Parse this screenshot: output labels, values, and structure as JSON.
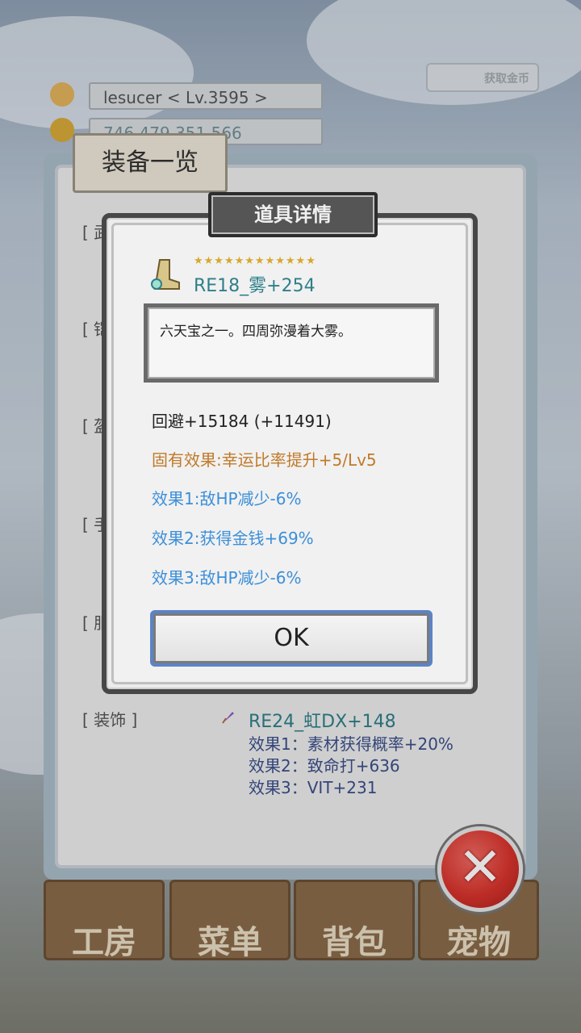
{
  "player": {
    "name_level": "lesucer    < Lv.3595 >",
    "gold": "746,479,351,566"
  },
  "auto_button_label": "获取金币",
  "bottom_nav": [
    {
      "label": "工房"
    },
    {
      "label": "菜单"
    },
    {
      "label": "背包"
    },
    {
      "label": "宠物"
    }
  ],
  "equipment_panel": {
    "title": "装备一览",
    "slots": [
      "[ 武",
      "[ 铠",
      "[ 盔",
      "[ 手",
      "[ 服"
    ],
    "accessory": {
      "label": "[ 装饰 ]",
      "name": "RE24_虹DX+148",
      "effects": [
        "效果1：素材获得概率+20%",
        "效果2：致命打+636",
        "效果3：VIT+231"
      ]
    }
  },
  "dialog": {
    "title": "道具详情",
    "stars": "★★★★★★★★★★★★",
    "item_name": "RE18_雾+254",
    "description": "六天宝之一。四周弥漫着大雾。",
    "stat": "回避+15184 (+11491)",
    "inherent": "固有效果:幸运比率提升+5/Lv5",
    "effects": [
      "效果1:敌HP减少-6%",
      "效果2:获得金钱+69%",
      "效果3:敌HP减少-6%"
    ],
    "ok_label": "OK"
  },
  "colors": {
    "item_name": "#2f7f8a",
    "inherent": "#c07a2a",
    "effect": "#3c8fd8",
    "accessory_effect": "#3b4f8a"
  }
}
